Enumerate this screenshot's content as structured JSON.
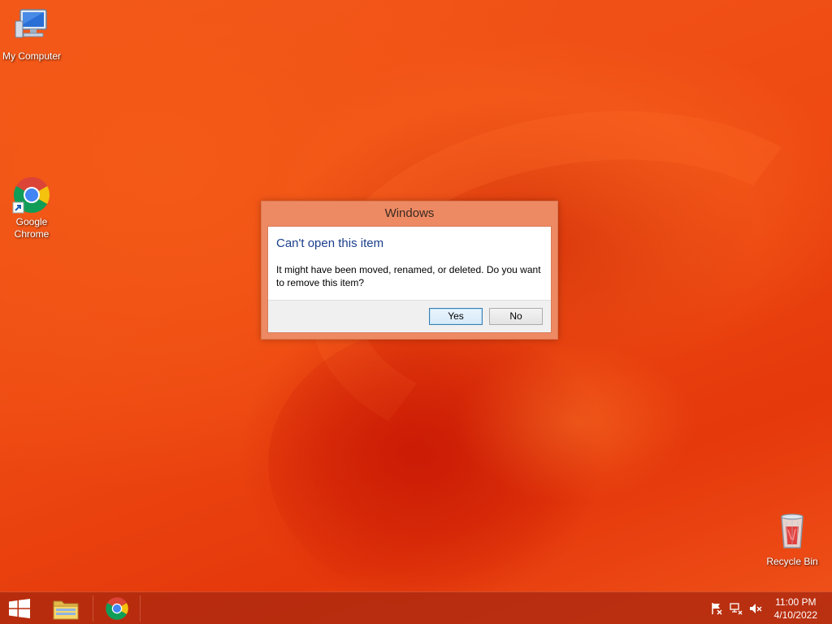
{
  "desktop": {
    "icons": [
      {
        "label": "My Computer",
        "icon": "computer-icon"
      },
      {
        "label_line1": "Google",
        "label_line2": "Chrome",
        "icon": "chrome-icon"
      },
      {
        "label": "Recycle Bin",
        "icon": "recycle-bin-icon"
      }
    ]
  },
  "dialog": {
    "title": "Windows",
    "heading": "Can't open this item",
    "message": "It might have been moved, renamed, or deleted. Do you want to remove this item?",
    "yes_label": "Yes",
    "no_label": "No"
  },
  "taskbar": {
    "start_icon": "windows-start-icon",
    "pinned": [
      "file-explorer-icon",
      "chrome-icon"
    ],
    "tray_icons": [
      "action-center-flag-icon",
      "network-icon",
      "volume-muted-icon"
    ],
    "time": "11:00 PM",
    "date": "4/10/2022"
  },
  "colors": {
    "desktop_bg": "#ee4a12",
    "dialog_frame": "#ee8a63",
    "heading_blue": "#1b3f8c",
    "taskbar": "#aa2810"
  }
}
